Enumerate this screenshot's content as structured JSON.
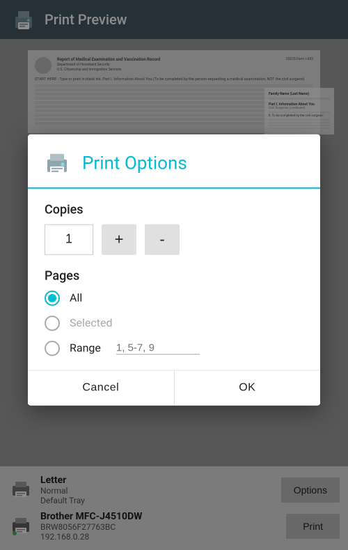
{
  "topBar": {
    "title": "Print Preview",
    "iconAlt": "print-preview-icon"
  },
  "dialog": {
    "title": "Print Options",
    "iconAlt": "print-icon",
    "copies": {
      "label": "Copies",
      "value": "1",
      "incrementLabel": "+",
      "decrementLabel": "-"
    },
    "pages": {
      "label": "Pages",
      "options": [
        {
          "id": "all",
          "label": "All",
          "selected": true,
          "enabled": true
        },
        {
          "id": "selected",
          "label": "Selected",
          "selected": false,
          "enabled": false
        },
        {
          "id": "range",
          "label": "Range",
          "selected": false,
          "enabled": true
        }
      ],
      "rangePlaceholder": "1, 5-7, 9"
    },
    "cancelLabel": "Cancel",
    "okLabel": "OK"
  },
  "bottomBar": {
    "printers": [
      {
        "name": "Letter",
        "line1": "Normal",
        "line2": "Default Tray",
        "hasGreenDot": false
      },
      {
        "name": "Brother MFC-J4510DW",
        "line1": "BRW8056F27763BC",
        "line2": "192.168.0.28",
        "hasGreenDot": true
      }
    ],
    "optionsLabel": "Options",
    "printLabel": "Print"
  },
  "docPreview": {
    "reportTitle": "Report of Medical Examination and Vaccination Record",
    "deptLabel": "Department of Homeland Security",
    "formLabel": "USCIS Form I-693",
    "bodyText": "START HERE - Type or print in black ink. Part I. Information About You (To be completed by the person requesting a medical examination; NOT the civil surgeon)"
  }
}
